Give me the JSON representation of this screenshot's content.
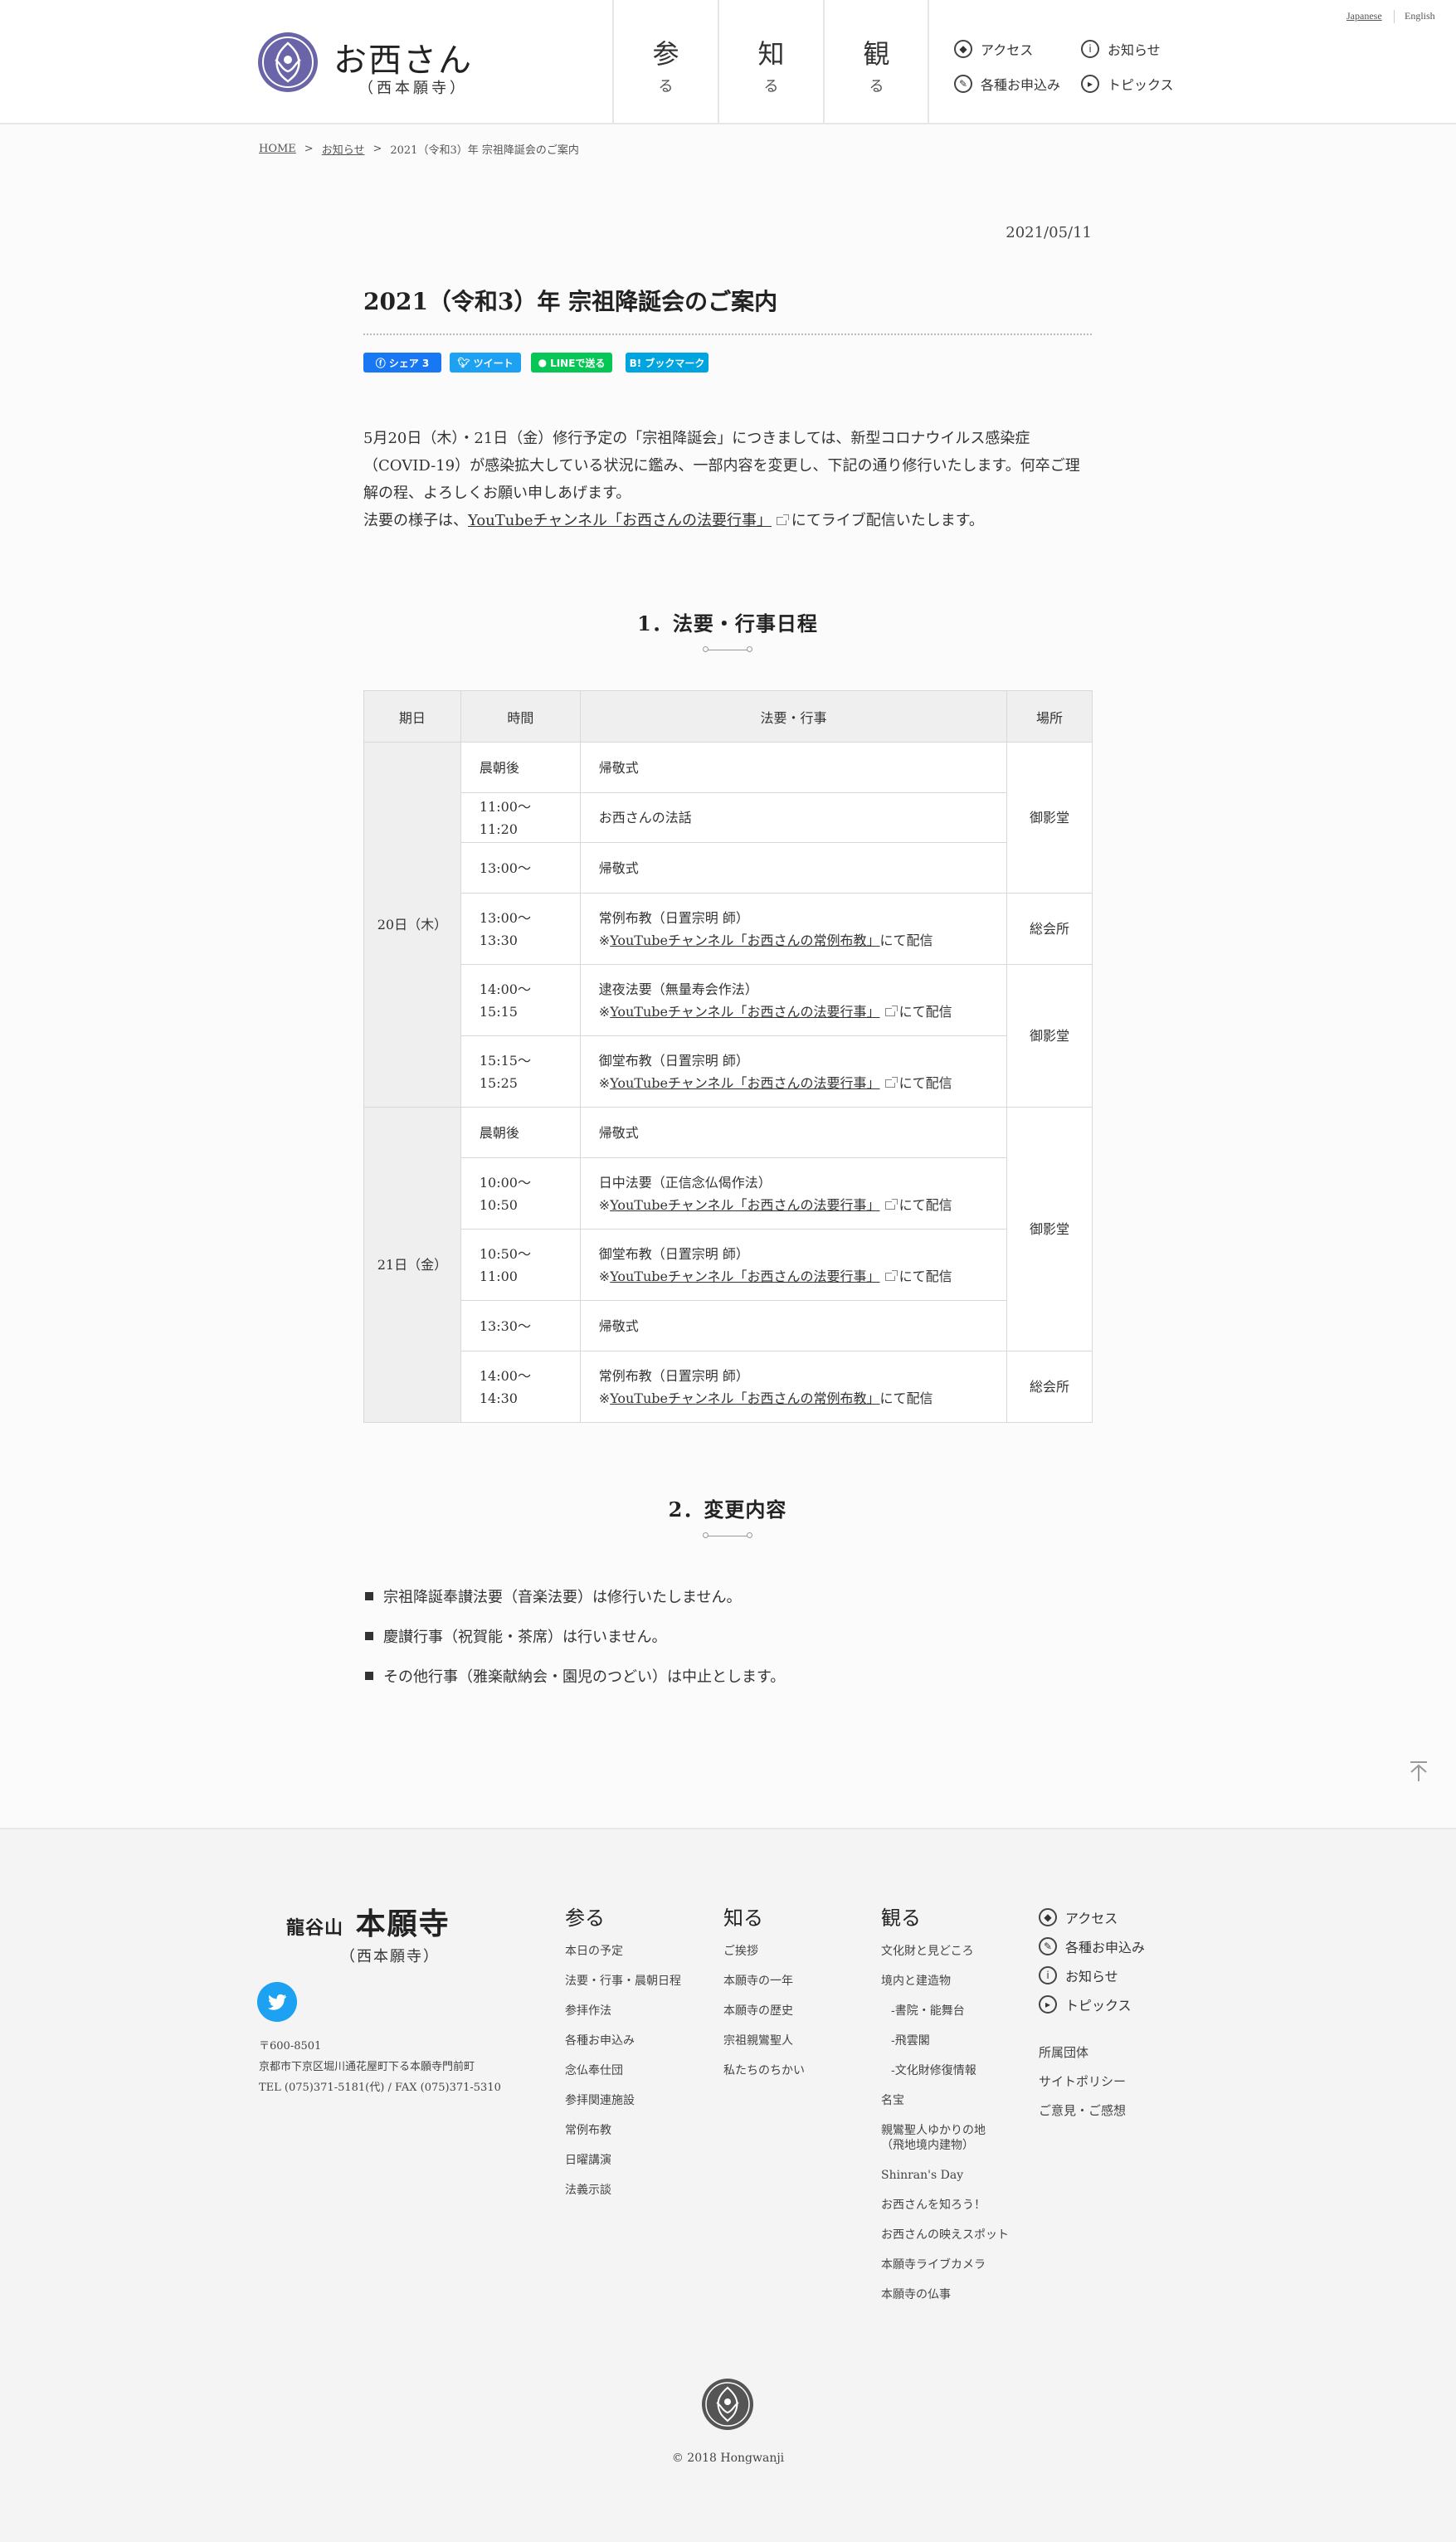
{
  "header": {
    "logo_text": "お西さん",
    "logo_sub": "（西本願寺）",
    "nav": [
      {
        "big": "参",
        "small": "る"
      },
      {
        "big": "知",
        "small": "る"
      },
      {
        "big": "観",
        "small": "る"
      }
    ],
    "subnav": [
      {
        "label": "アクセス",
        "icon": "compass-icon"
      },
      {
        "label": "お知らせ",
        "icon": "info-icon"
      },
      {
        "label": "各種お申込み",
        "icon": "pen-icon"
      },
      {
        "label": "トピックス",
        "icon": "flag-icon"
      }
    ],
    "lang": {
      "ja": "Japanese",
      "en": "English"
    }
  },
  "breadcrumb": {
    "home": "HOME",
    "news": "お知らせ",
    "current": "2021（令和3）年 宗祖降誕会のご案内",
    "sep": ">"
  },
  "article": {
    "date": "2021/05/11",
    "title": "2021（令和3）年 宗祖降誕会のご案内",
    "social": {
      "facebook": "シェア 3",
      "twitter": "ツイート",
      "line": "LINEで送る",
      "hatena": "B! ブックマーク"
    },
    "intro": {
      "p1": "5月20日（木）・21日（金）修行予定の「宗祖降誕会」につきましては、新型コロナウイルス感染症（COVID-19）が感染拡大している状況に鑑み、一部内容を変更し、下記の通り修行いたします。何卒ご理解の程、よろしくお願い申しあげます。",
      "p2_pre": "法要の様子は、",
      "p2_link": "YouTubeチャンネル「お西さんの法要行事」",
      "p2_post": "にてライブ配信いたします。"
    },
    "section1": "1．法要・行事日程",
    "table": {
      "headers": [
        "期日",
        "時間",
        "法要・行事",
        "場所"
      ],
      "day1": "20日（木）",
      "day2": "21日（金）",
      "rows": [
        {
          "time": "晨朝後",
          "event": "帰敬式"
        },
        {
          "time": "11:00～11:20",
          "event": "お西さんの法話"
        },
        {
          "time": "13:00～",
          "event": "帰敬式"
        },
        {
          "time": "13:00～13:30",
          "event": "常例布教（日置宗明 師）",
          "pre": "※",
          "link": "YouTubeチャンネル「お西さんの常例布教」",
          "post": "にて配信"
        },
        {
          "time": "14:00～15:15",
          "event": "逮夜法要（無量寿会作法）",
          "pre": "※",
          "link": "YouTubeチャンネル「お西さんの法要行事」",
          "post": "にて配信"
        },
        {
          "time": "15:15～15:25",
          "event": "御堂布教（日置宗明 師）",
          "pre": "※",
          "link": "YouTubeチャンネル「お西さんの法要行事」",
          "post": "にて配信"
        },
        {
          "time": "晨朝後",
          "event": "帰敬式"
        },
        {
          "time": "10:00～10:50",
          "event": "日中法要（正信念仏偈作法）",
          "pre": "※",
          "link": "YouTubeチャンネル「お西さんの法要行事」",
          "post": "にて配信"
        },
        {
          "time": "10:50～11:00",
          "event": "御堂布教（日置宗明 師）",
          "pre": "※",
          "link": "YouTubeチャンネル「お西さんの法要行事」",
          "post": "にて配信"
        },
        {
          "time": "13:30～",
          "event": "帰敬式"
        },
        {
          "time": "14:00～14:30",
          "event": "常例布教（日置宗明 師）",
          "pre": "※",
          "link": "YouTubeチャンネル「お西さんの常例布教」",
          "post": "にて配信"
        }
      ],
      "places": {
        "goeido": "御影堂",
        "sokaisho": "総会所"
      }
    },
    "section2": "2．変更内容",
    "changes": [
      "宗祖降誕奉讃法要（音楽法要）は修行いたしません。",
      "慶讃行事（祝賀能・茶席）は行いません。",
      "その他行事（雅楽献納会・園児のつどい）は中止とします。"
    ]
  },
  "footer": {
    "logo_small": "龍谷山",
    "logo_big": "本願寺",
    "logo_sub": "（西本願寺）",
    "address": [
      "〒600-8501",
      "京都市下京区堀川通花屋町下る本願寺門前町",
      "TEL (075)371-5181(代) / FAX (075)371-5310"
    ],
    "col1": {
      "title": "参る",
      "items": [
        "本日の予定",
        "法要・行事・晨朝日程",
        "参拝作法",
        "各種お申込み",
        "念仏奉仕団",
        "参拝関連施設",
        "常例布教",
        "日曜講演",
        "法義示談"
      ]
    },
    "col2": {
      "title": "知る",
      "items": [
        "ご挨拶",
        "本願寺の一年",
        "本願寺の歴史",
        "宗祖親鸞聖人",
        "私たちのちかい"
      ]
    },
    "col3": {
      "title": "観る",
      "items": [
        "文化財と見どころ",
        "境内と建造物",
        "-書院・能舞台",
        "-飛雲閣",
        "-文化財修復情報",
        "名宝",
        "親鸞聖人ゆかりの地",
        "（飛地境内建物）",
        "Shinran's Day",
        "お西さんを知ろう！",
        "お西さんの映えスポット",
        "本願寺ライブカメラ",
        "本願寺の仏事"
      ]
    },
    "sub": [
      "アクセス",
      "各種お申込み",
      "お知らせ",
      "トピックス"
    ],
    "misc": [
      "所属団体",
      "サイトポリシー",
      "ご意見・ご感想"
    ],
    "copyright": "© 2018 Hongwanji"
  }
}
